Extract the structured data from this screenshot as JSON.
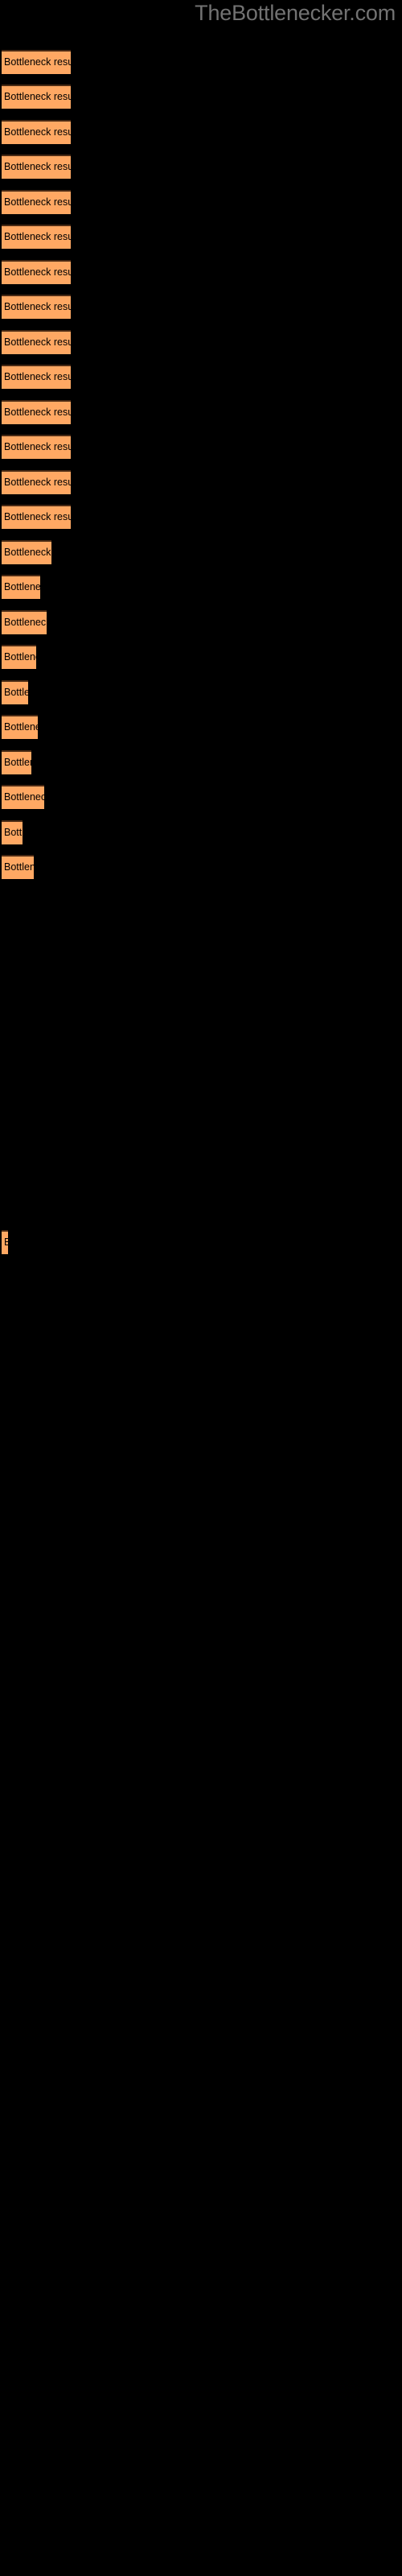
{
  "watermark": {
    "text": "TheBottlenecker.com",
    "color": "#727272"
  },
  "background_color": "#000000",
  "bar_color": "#FFA863",
  "bar_border_color": "#4a2a14",
  "label_color": "#000000",
  "bar_label": "Bottleneck result",
  "chart_data": {
    "type": "bar",
    "orientation": "horizontal",
    "title": "",
    "subtitle": "",
    "xlabel": "",
    "ylabel": "",
    "grid": false,
    "legend": false,
    "axis_visible": false,
    "tick_labels": [],
    "categories": [
      "Bottleneck result",
      "Bottleneck result",
      "Bottleneck result",
      "Bottleneck result",
      "Bottleneck result",
      "Bottleneck result",
      "Bottleneck result",
      "Bottleneck result",
      "Bottleneck result",
      "Bottleneck result",
      "Bottleneck result",
      "Bottleneck result",
      "Bottleneck result",
      "Bottleneck result",
      "Bottleneck result",
      "Bottleneck result",
      "Bottleneck result",
      "Bottleneck result",
      "Bottleneck result",
      "Bottleneck result",
      "Bottleneck result",
      "Bottleneck result",
      "Bottleneck result",
      "Bottleneck result",
      "Bottleneck result"
    ],
    "values": [
      86,
      86,
      86,
      86,
      86,
      86,
      86,
      86,
      86,
      86,
      86,
      86,
      86,
      86,
      62,
      48,
      56,
      43,
      33,
      45,
      37,
      53,
      26,
      40,
      8
    ],
    "xlim": [
      0,
      500
    ],
    "bar_labels_inside": true,
    "bars": [
      {
        "label": "Bottleneck result",
        "top": 62,
        "width": 86
      },
      {
        "label": "Bottleneck result",
        "top": 105,
        "width": 86
      },
      {
        "label": "Bottleneck result",
        "top": 149,
        "width": 86
      },
      {
        "label": "Bottleneck result",
        "top": 192,
        "width": 86
      },
      {
        "label": "Bottleneck result",
        "top": 236,
        "width": 86
      },
      {
        "label": "Bottleneck result",
        "top": 279,
        "width": 86
      },
      {
        "label": "Bottleneck result",
        "top": 323,
        "width": 86
      },
      {
        "label": "Bottleneck result",
        "top": 366,
        "width": 86
      },
      {
        "label": "Bottleneck result",
        "top": 410,
        "width": 86
      },
      {
        "label": "Bottleneck result",
        "top": 453,
        "width": 86
      },
      {
        "label": "Bottleneck result",
        "top": 497,
        "width": 86
      },
      {
        "label": "Bottleneck result",
        "top": 540,
        "width": 86
      },
      {
        "label": "Bottleneck result",
        "top": 584,
        "width": 86
      },
      {
        "label": "Bottleneck result",
        "top": 627,
        "width": 86
      },
      {
        "label": "Bottleneck result",
        "top": 671,
        "width": 62
      },
      {
        "label": "Bottleneck result",
        "top": 714,
        "width": 48
      },
      {
        "label": "Bottleneck result",
        "top": 758,
        "width": 56
      },
      {
        "label": "Bottleneck result",
        "top": 801,
        "width": 43
      },
      {
        "label": "Bottleneck result",
        "top": 845,
        "width": 33
      },
      {
        "label": "Bottleneck result",
        "top": 888,
        "width": 45
      },
      {
        "label": "Bottleneck result",
        "top": 932,
        "width": 37
      },
      {
        "label": "Bottleneck result",
        "top": 975,
        "width": 53
      },
      {
        "label": "Bottleneck result",
        "top": 1019,
        "width": 26
      },
      {
        "label": "Bottleneck result",
        "top": 1062,
        "width": 40
      },
      {
        "label": "Bottleneck result",
        "top": 1528,
        "width": 8
      }
    ]
  }
}
